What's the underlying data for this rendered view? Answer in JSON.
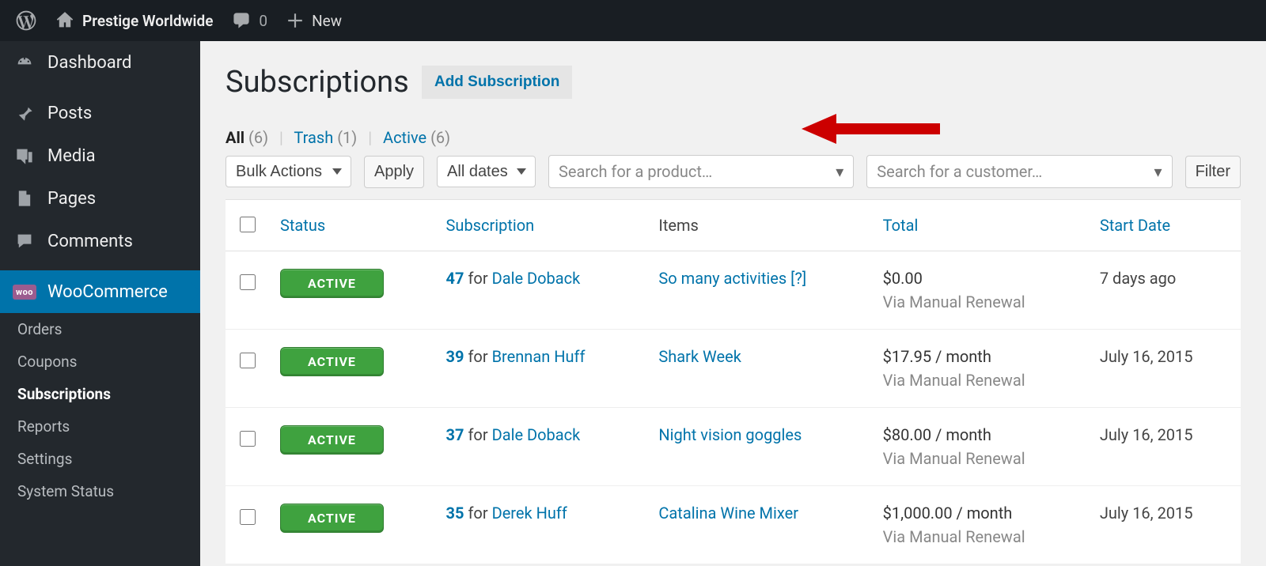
{
  "adminbar": {
    "site_title": "Prestige Worldwide",
    "comments_count": "0",
    "new_label": "New"
  },
  "sidebar": {
    "dashboard": "Dashboard",
    "posts": "Posts",
    "media": "Media",
    "pages": "Pages",
    "comments": "Comments",
    "woocommerce": "WooCommerce",
    "woo_badge": "woo",
    "sub": {
      "orders": "Orders",
      "coupons": "Coupons",
      "subscriptions": "Subscriptions",
      "reports": "Reports",
      "settings": "Settings",
      "system_status": "System Status"
    }
  },
  "page": {
    "title": "Subscriptions",
    "add_btn": "Add Subscription"
  },
  "filters": {
    "all_label": "All",
    "all_count": "(6)",
    "trash_label": "Trash",
    "trash_count": "(1)",
    "active_label": "Active",
    "active_count": "(6)"
  },
  "tablenav": {
    "bulk_label": "Bulk Actions",
    "apply": "Apply",
    "all_dates": "All dates",
    "product_placeholder": "Search for a product…",
    "customer_placeholder": "Search for a customer…",
    "filter": "Filter"
  },
  "columns": {
    "status": "Status",
    "subscription": "Subscription",
    "items": "Items",
    "total": "Total",
    "start_date": "Start Date"
  },
  "rows": [
    {
      "status": "ACTIVE",
      "num": "47",
      "for": "for",
      "customer": "Dale Doback",
      "items": "So many activities [?]",
      "total": "$0.00",
      "via": "Via Manual Renewal",
      "start": "7 days ago"
    },
    {
      "status": "ACTIVE",
      "num": "39",
      "for": "for",
      "customer": "Brennan Huff",
      "items": "Shark Week",
      "total": "$17.95 / month",
      "via": "Via Manual Renewal",
      "start": "July 16, 2015"
    },
    {
      "status": "ACTIVE",
      "num": "37",
      "for": "for",
      "customer": "Dale Doback",
      "items": "Night vision goggles",
      "total": "$80.00 / month",
      "via": "Via Manual Renewal",
      "start": "July 16, 2015"
    },
    {
      "status": "ACTIVE",
      "num": "35",
      "for": "for",
      "customer": "Derek Huff",
      "items": "Catalina Wine Mixer",
      "total": "$1,000.00 / month",
      "via": "Via Manual Renewal",
      "start": "July 16, 2015"
    }
  ]
}
